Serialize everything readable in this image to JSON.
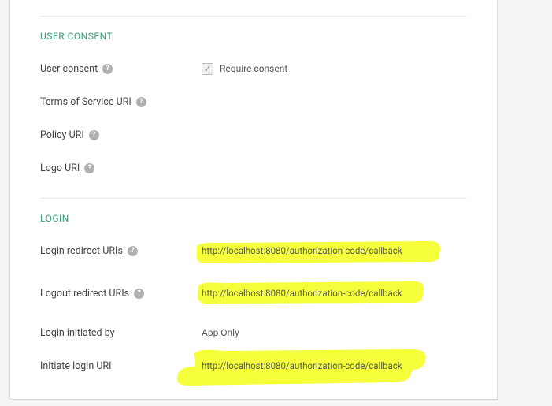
{
  "sections": {
    "user_consent": {
      "title": "USER CONSENT",
      "fields": {
        "user_consent_label": "User consent",
        "require_consent_label": "Require consent",
        "tos_label": "Terms of Service URI",
        "policy_label": "Policy URI",
        "logo_label": "Logo URI"
      }
    },
    "login": {
      "title": "LOGIN",
      "fields": {
        "login_redirect_label": "Login redirect URIs",
        "login_redirect_value": "http://localhost:8080/authorization-code/callback",
        "logout_redirect_label": "Logout redirect URIs",
        "logout_redirect_value": "http://localhost:8080/authorization-code/callback",
        "login_initiated_label": "Login initiated by",
        "login_initiated_value": "App Only",
        "initiate_login_label": "Initiate login URI",
        "initiate_login_value": "http://localhost:8080/authorization-code/callback"
      }
    }
  },
  "glyphs": {
    "help": "?",
    "check": "✓"
  },
  "colors": {
    "highlight": "#f6ff3b",
    "accent": "#33a07a"
  }
}
